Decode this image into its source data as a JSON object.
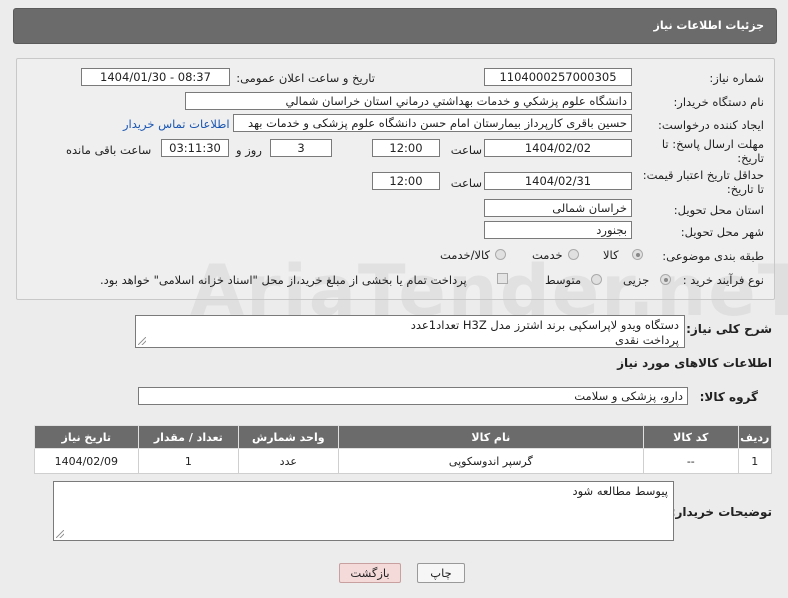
{
  "header": {
    "title": "جزئیات اطلاعات نیاز"
  },
  "watermark": "AriaTender.neT",
  "form": {
    "need_number": {
      "label": "شماره نیاز:",
      "value": "1104000257000305"
    },
    "announce_datetime": {
      "label": "تاریخ و ساعت اعلان عمومی:",
      "value": "1404/01/30 - 08:37"
    },
    "buyer_org": {
      "label": "نام دستگاه خریدار:",
      "value": "دانشگاه علوم پزشکي و خدمات بهداشتي درماني استان خراسان شمالي"
    },
    "creator": {
      "label": "ایجاد کننده درخواست:",
      "value": "حسین باقری کارپرداز بیمارستان امام حسن دانشگاه علوم پزشکی و خدمات بهد",
      "contact_link": "اطلاعات تماس خریدار"
    },
    "reply_deadline": {
      "label": "مهلت ارسال پاسخ: تا تاریخ:",
      "date": "1404/02/02",
      "time_label": "ساعت",
      "time": "12:00",
      "days": "3",
      "days_label": "روز و",
      "remaining": "03:11:30",
      "remaining_label": "ساعت باقی مانده"
    },
    "price_validity": {
      "label": "حداقل تاریخ اعتبار قیمت: تا تاریخ:",
      "date": "1404/02/31",
      "time_label": "ساعت",
      "time": "12:00"
    },
    "delivery_province": {
      "label": "استان محل تحویل:",
      "value": "خراسان شمالی"
    },
    "delivery_city": {
      "label": "شهر محل تحویل:",
      "value": "بجنورد"
    },
    "category": {
      "label": "طبقه بندی موضوعی:",
      "options": [
        "کالا",
        "خدمت",
        "کالا/خدمت"
      ]
    },
    "purchase_type": {
      "label": "نوع فرآیند خرید :",
      "options": [
        "جزیی",
        "متوسط"
      ],
      "note": "پرداخت تمام یا بخشی از مبلغ خرید،از محل \"اسناد خزانه اسلامی\" خواهد بود."
    }
  },
  "description": {
    "label": "شرح کلی نیاز:",
    "line1": "دستگاه ویدو لاپراسکپی برند اشترز مدل H3Z تعداد1عدد",
    "line2": "پرداخت نقدی"
  },
  "items_section": {
    "title": "اطلاعات کالاهای مورد نیاز",
    "group_label": "گروه کالا:",
    "group_value": "دارو، پزشکی و سلامت"
  },
  "table": {
    "headers": [
      "ردیف",
      "کد کالا",
      "نام کالا",
      "واحد شمارش",
      "تعداد / مقدار",
      "تاریخ نیاز"
    ],
    "rows": [
      [
        "1",
        "--",
        "گرسپر اندوسکوپی",
        "عدد",
        "1",
        "1404/02/09"
      ]
    ]
  },
  "buyer_notes": {
    "label": "توضیحات خریدار:",
    "value": "پیوسط مطالعه شود"
  },
  "buttons": {
    "print": "چاپ",
    "back": "بازگشت"
  }
}
